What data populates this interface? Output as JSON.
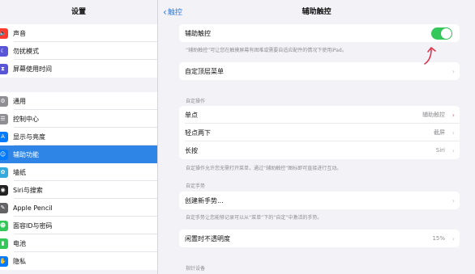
{
  "sidebar": {
    "title": "设置",
    "group1": [
      {
        "label": "声音",
        "icon": "sound-icon",
        "color": "#ff3b30",
        "glyph": "🔈"
      },
      {
        "label": "勿扰模式",
        "icon": "moon-icon",
        "color": "#5856d6",
        "glyph": "☾"
      },
      {
        "label": "屏幕使用时间",
        "icon": "hourglass-icon",
        "color": "#5856d6",
        "glyph": "⧗"
      }
    ],
    "group2": [
      {
        "label": "通用",
        "icon": "gear-icon",
        "color": "#8e8e93",
        "glyph": "⚙"
      },
      {
        "label": "控制中心",
        "icon": "control-center-icon",
        "color": "#8e8e93",
        "glyph": "☰"
      },
      {
        "label": "显示与亮度",
        "icon": "display-icon",
        "color": "#007aff",
        "glyph": "A"
      },
      {
        "label": "辅助功能",
        "icon": "accessibility-icon",
        "color": "#007aff",
        "glyph": "☺",
        "active": true
      },
      {
        "label": "墙纸",
        "icon": "wallpaper-icon",
        "color": "#34aadc",
        "glyph": "✿"
      },
      {
        "label": "Siri与搜索",
        "icon": "siri-icon",
        "color": "#222222",
        "glyph": "◉"
      },
      {
        "label": "Apple Pencil",
        "icon": "pencil-icon",
        "color": "#636366",
        "glyph": "✎"
      },
      {
        "label": "面容ID与密码",
        "icon": "face-id-icon",
        "color": "#34c759",
        "glyph": "☻"
      },
      {
        "label": "电池",
        "icon": "battery-icon",
        "color": "#34c759",
        "glyph": "▮"
      },
      {
        "label": "隐私",
        "icon": "hand-icon",
        "color": "#007aff",
        "glyph": "✋"
      }
    ]
  },
  "nav": {
    "back_label": "触控",
    "back_glyph": "‹",
    "title": "辅助触控"
  },
  "assistive": {
    "toggle_label": "辅助触控",
    "toggle_state": "on",
    "caption": "“辅助触控”可让您在触摸屏幕有困难或需要自适应配件的情况下使用iPad。"
  },
  "top_menu": {
    "label": "自定顶层菜单"
  },
  "custom_actions": {
    "header": "自定操作",
    "rows": [
      {
        "label": "单点",
        "value": "辅助触控"
      },
      {
        "label": "轻点两下",
        "value": "截屏"
      },
      {
        "label": "长按",
        "value": "Siri"
      }
    ],
    "caption": "自定操作允许您无需打开菜单，通过“辅助触控”图标即可直接进行互动。"
  },
  "custom_gestures": {
    "header": "自定手势",
    "create_label": "创建新手势...",
    "caption": "自定手势让您能够记录可以从“菜单”下的“自定”中激活的手势。"
  },
  "idle_opacity": {
    "label": "闲置时不透明度",
    "value": "15%"
  },
  "pointer": {
    "header": "指针设备"
  },
  "chevron": "›",
  "accent": "#2e85e6",
  "toggle_color": "#34c759"
}
